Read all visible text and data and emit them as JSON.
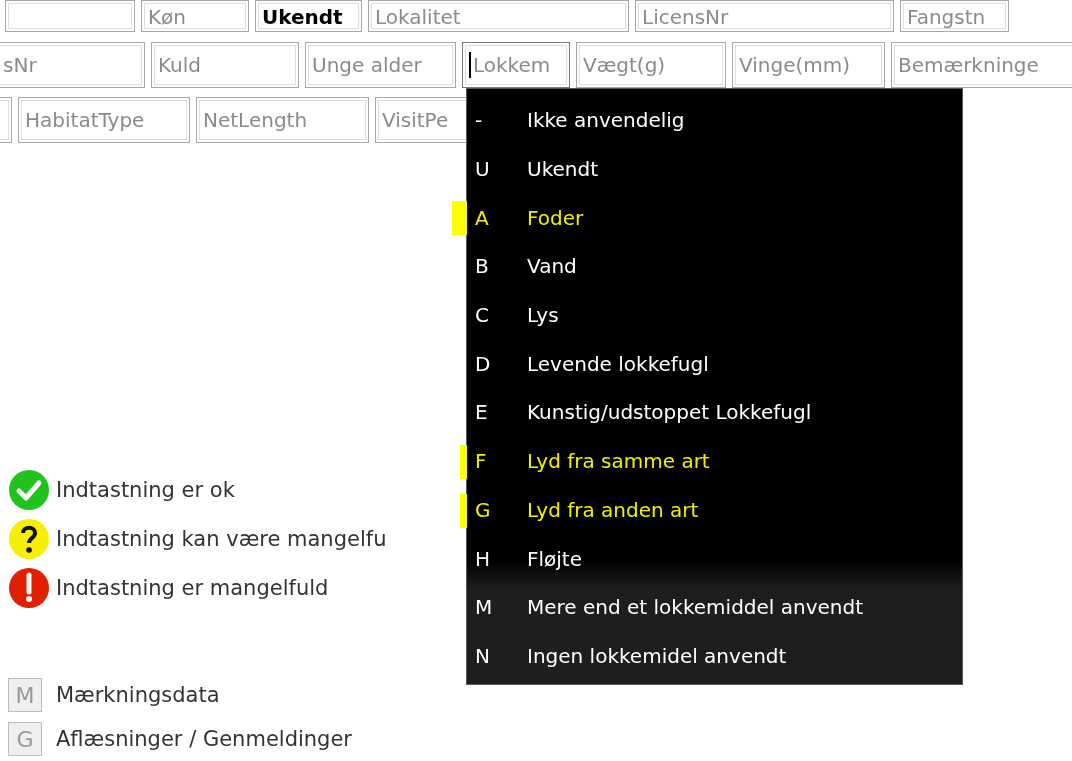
{
  "form_rows": [
    {
      "fields": [
        {
          "focused": false
        },
        {
          "placeholder": "Køn",
          "focused": false
        },
        {
          "value": "Ukendt",
          "focused": false
        },
        {
          "placeholder": "Lokalitet",
          "focused": false
        },
        {
          "placeholder": "LicensNr",
          "focused": false
        },
        {
          "placeholder": "Fangstn",
          "focused": false
        }
      ]
    },
    {
      "fields": [
        {
          "placeholder": "sNr",
          "focused": false
        },
        {
          "placeholder": "Kuld",
          "focused": false
        },
        {
          "placeholder": "Unge alder",
          "focused": false
        },
        {
          "placeholder": "Lokkem",
          "focused": true
        },
        {
          "placeholder": "Vægt(g)",
          "focused": false
        },
        {
          "placeholder": "Vinge(mm)",
          "focused": false
        },
        {
          "placeholder": "Bemærkninge",
          "focused": false
        }
      ]
    },
    {
      "fields": [
        {
          "focused": false
        },
        {
          "placeholder": "HabitatType",
          "focused": false
        },
        {
          "placeholder": "NetLength",
          "focused": false
        },
        {
          "placeholder": "VisitPe",
          "focused": false
        }
      ]
    }
  ],
  "dropdown": {
    "items": [
      {
        "code": "-",
        "label": "Ikke anvendelig",
        "highlighted": false
      },
      {
        "code": "U",
        "label": "Ukendt",
        "highlighted": false
      },
      {
        "code": "A",
        "label": "Foder",
        "highlighted": true
      },
      {
        "code": "B",
        "label": "Vand",
        "highlighted": false
      },
      {
        "code": "C",
        "label": "Lys",
        "highlighted": false
      },
      {
        "code": "D",
        "label": "Levende lokkefugl",
        "highlighted": false
      },
      {
        "code": "E",
        "label": "Kunstig/udstoppet Lokkefugl",
        "highlighted": false
      },
      {
        "code": "F",
        "label": "Lyd fra samme art",
        "highlighted": true
      },
      {
        "code": "G",
        "label": "Lyd fra anden art",
        "highlighted": true
      },
      {
        "code": "H",
        "label": "Fløjte",
        "highlighted": false
      },
      {
        "code": "M",
        "label": "Mere end et lokkemiddel anvendt",
        "highlighted": false
      },
      {
        "code": "N",
        "label": "Ingen lokkemidel anvendt",
        "highlighted": false
      }
    ]
  },
  "legend": [
    {
      "kind": "ok",
      "text": "Indtastning er ok"
    },
    {
      "kind": "warning",
      "text": "Indtastning kan være mangelfu"
    },
    {
      "kind": "error",
      "text": "Indtastning er mangelfuld"
    }
  ],
  "sections": [
    {
      "key": "M",
      "label": "Mærkningsdata"
    },
    {
      "key": "G",
      "label": "Aflæsninger / Genmeldinger"
    }
  ]
}
